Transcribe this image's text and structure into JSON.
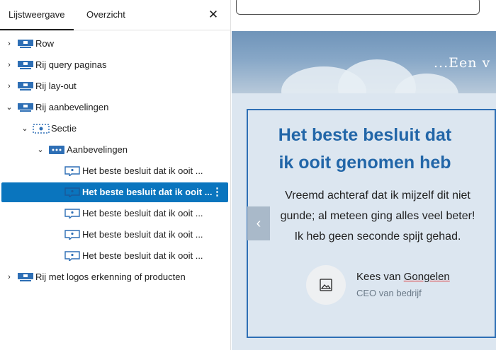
{
  "tabs": {
    "list_view": "Lijstweergave",
    "overview": "Overzicht"
  },
  "tree": [
    {
      "label": "Row",
      "chevron": "›",
      "icon": "row-block-icon"
    },
    {
      "label": "Rij query paginas",
      "chevron": "›",
      "icon": "row-block-icon"
    },
    {
      "label": "Rij lay-out",
      "chevron": "›",
      "icon": "row-block-icon"
    },
    {
      "label": "Rij aanbevelingen",
      "chevron": "⌄",
      "icon": "row-block-icon"
    },
    {
      "label": "Sectie",
      "chevron": "⌄",
      "icon": "section-block-icon"
    },
    {
      "label": "Aanbevelingen",
      "chevron": "⌄",
      "icon": "slider-block-icon"
    },
    {
      "label": "Het beste besluit dat ik ooit ...",
      "icon": "testimonial-block-icon"
    },
    {
      "label": "Het beste besluit dat ik ooit ...",
      "icon": "testimonial-block-icon",
      "selected": true
    },
    {
      "label": "Het beste besluit dat ik ooit ...",
      "icon": "testimonial-block-icon"
    },
    {
      "label": "Het beste besluit dat ik ooit ...",
      "icon": "testimonial-block-icon"
    },
    {
      "label": "Het beste besluit dat ik ooit ...",
      "icon": "testimonial-block-icon"
    },
    {
      "label": "Rij met logos erkenning of producten",
      "chevron": "›",
      "icon": "row-block-icon"
    }
  ],
  "canvas": {
    "hero_title": "...Een v",
    "testimonial": {
      "title_line1": "Het beste besluit dat",
      "title_line2": "ik ooit genomen heb",
      "text": "Vreemd achteraf dat ik mijzelf dit niet gunde; al meteen ging alles veel beter! Ik heb geen seconde spijt gehad.",
      "name_first": "Kees van ",
      "name_last": "Gongelen",
      "role": "CEO van bedrijf"
    }
  },
  "colors": {
    "accent": "#0a75be",
    "card_border": "#2e6fb5",
    "title": "#2266a8",
    "canvas_bg": "#dce6f0"
  }
}
